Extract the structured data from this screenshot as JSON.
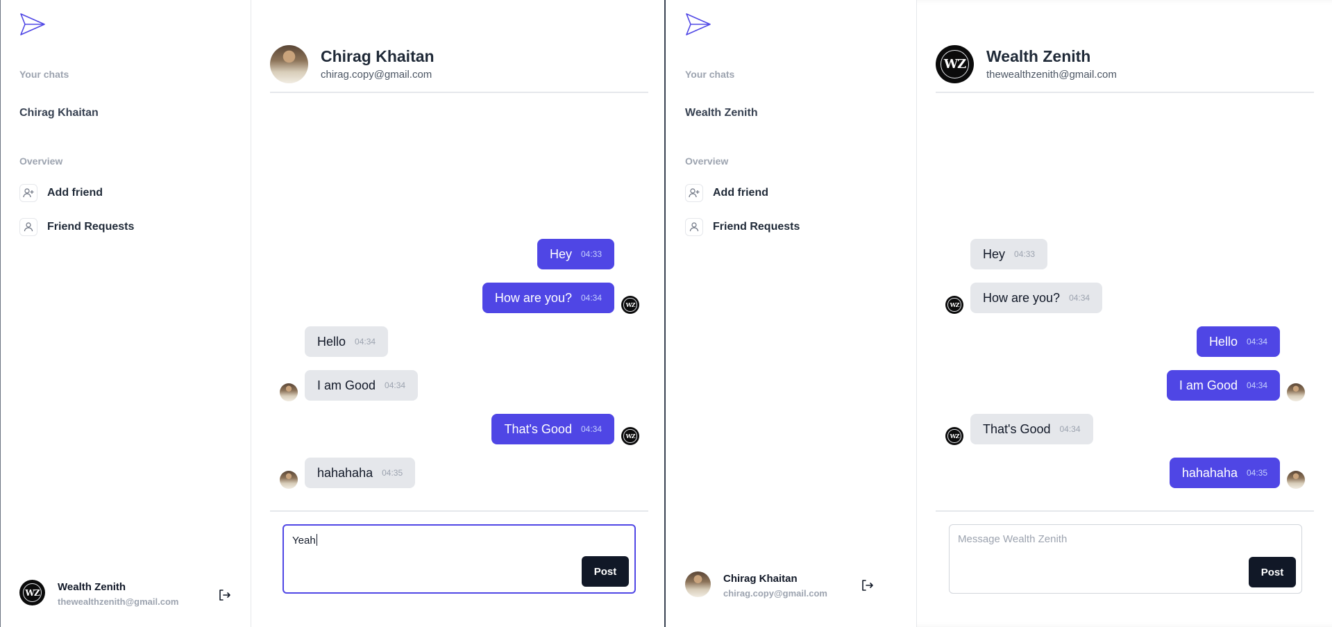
{
  "left": {
    "sidebar": {
      "your_chats_label": "Your chats",
      "chats": [
        "Chirag Khaitan"
      ],
      "overview_label": "Overview",
      "nav": [
        {
          "label": "Add friend",
          "icon": "user-plus-icon"
        },
        {
          "label": "Friend Requests",
          "icon": "user-icon"
        }
      ],
      "user": {
        "name": "Wealth Zenith",
        "email": "thewealthzenith@gmail.com",
        "initials": "WZ"
      }
    },
    "header": {
      "name": "Chirag Khaitan",
      "email": "chirag.copy@gmail.com"
    },
    "messages": [
      {
        "text": "Hey",
        "time": "04:33",
        "side": "sent",
        "avatar": false
      },
      {
        "text": "How are you?",
        "time": "04:34",
        "side": "sent",
        "avatar": true
      },
      {
        "text": "Hello",
        "time": "04:34",
        "side": "recv",
        "avatar": false
      },
      {
        "text": "I am Good",
        "time": "04:34",
        "side": "recv",
        "avatar": true
      },
      {
        "text": "That's Good",
        "time": "04:34",
        "side": "sent",
        "avatar": true
      },
      {
        "text": "hahahaha",
        "time": "04:35",
        "side": "recv",
        "avatar": true
      }
    ],
    "composer": {
      "value": "Yeah",
      "post_label": "Post"
    }
  },
  "right": {
    "sidebar": {
      "your_chats_label": "Your chats",
      "chats": [
        "Wealth Zenith"
      ],
      "overview_label": "Overview",
      "nav": [
        {
          "label": "Add friend",
          "icon": "user-plus-icon"
        },
        {
          "label": "Friend Requests",
          "icon": "user-icon"
        }
      ],
      "user": {
        "name": "Chirag Khaitan",
        "email": "chirag.copy@gmail.com"
      }
    },
    "header": {
      "name": "Wealth Zenith",
      "email": "thewealthzenith@gmail.com",
      "initials": "WZ"
    },
    "messages": [
      {
        "text": "Hey",
        "time": "04:33",
        "side": "recv",
        "avatar": false
      },
      {
        "text": "How are you?",
        "time": "04:34",
        "side": "recv",
        "avatar": true
      },
      {
        "text": "Hello",
        "time": "04:34",
        "side": "sent",
        "avatar": false
      },
      {
        "text": "I am Good",
        "time": "04:34",
        "side": "sent",
        "avatar": true
      },
      {
        "text": "That's Good",
        "time": "04:34",
        "side": "recv",
        "avatar": true
      },
      {
        "text": "hahahaha",
        "time": "04:35",
        "side": "sent",
        "avatar": true
      }
    ],
    "composer": {
      "placeholder": "Message Wealth Zenith",
      "post_label": "Post"
    }
  },
  "colors": {
    "accent": "#4f46e5",
    "received_bubble": "#e5e7eb",
    "post_button": "#111827"
  }
}
